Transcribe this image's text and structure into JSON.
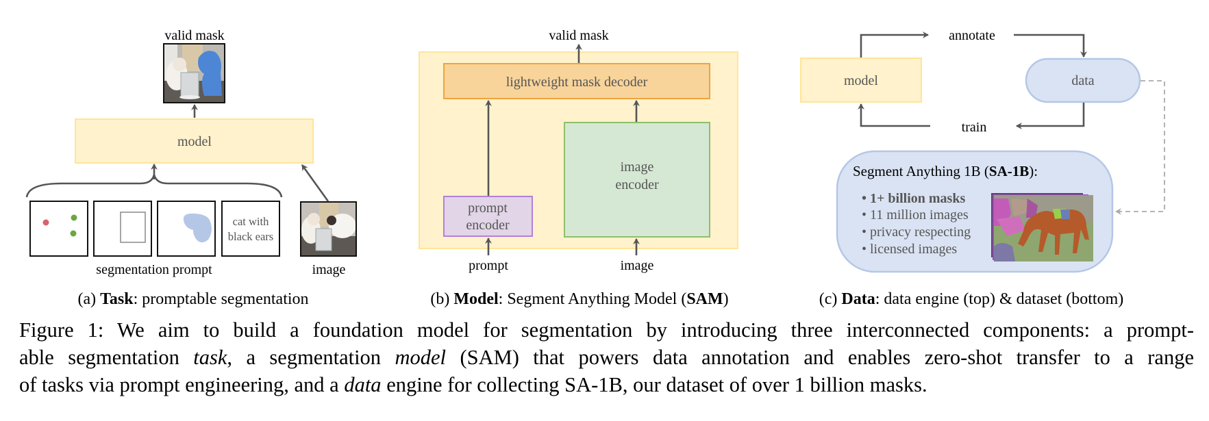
{
  "panel_a": {
    "output_label": "valid mask",
    "model_label": "model",
    "prompt_text_box": [
      "cat with",
      "black ears"
    ],
    "prompts_label": "segmentation prompt",
    "image_label": "image",
    "subcaption": {
      "prefix": "(a) ",
      "bold": "Task",
      "rest": ": promptable segmentation"
    },
    "point_colors": {
      "negative": "#d9636a",
      "positive": "#6aa83e"
    },
    "mask_color": "#b4c7e7"
  },
  "panel_b": {
    "output_label": "valid mask",
    "decoder_label": "lightweight mask decoder",
    "prompt_encoder_label": [
      "prompt",
      "encoder"
    ],
    "image_encoder_label": [
      "image",
      "encoder"
    ],
    "prompt_input_label": "prompt",
    "image_input_label": "image",
    "subcaption": {
      "prefix": "(b) ",
      "bold": "Model",
      "mid": ": Segment Anything Model (",
      "bold2": "SAM",
      "end": ")"
    }
  },
  "panel_c": {
    "model_label": "model",
    "data_label": "data",
    "annotate_label": "annotate",
    "train_label": "train",
    "dataset_title": {
      "prefix": "Segment Anything 1B (",
      "bold": "SA-1B",
      "end": "):"
    },
    "dataset_bullets": [
      {
        "text": "1+ billion masks",
        "bold": true
      },
      {
        "text": "11 million images",
        "bold": false
      },
      {
        "text": "privacy respecting",
        "bold": false
      },
      {
        "text": "licensed images",
        "bold": false
      }
    ],
    "subcaption": {
      "prefix": "(c) ",
      "bold": "Data",
      "rest": ": data engine (top) & dataset (bottom)"
    }
  },
  "colors": {
    "model_fill": "#fff2cc",
    "model_stroke": "#ffe599",
    "decoder_fill": "#f8d49a",
    "decoder_stroke": "#f0a43c",
    "prompt_enc_fill": "#e1d5e7",
    "prompt_enc_stroke": "#b57fd6",
    "image_enc_fill": "#d5e8d4",
    "image_enc_stroke": "#8fbf6b",
    "data_fill": "#dae3f3",
    "data_stroke": "#b4c7e7",
    "arrow": "#555555"
  },
  "figure_caption": {
    "lines": [
      [
        {
          "t": "Figure 1: We aim to build a foundation model for segmentation by introducing three interconnected components: a prompt-"
        }
      ],
      [
        {
          "t": "able segmentation "
        },
        {
          "t": "task",
          "i": true
        },
        {
          "t": ", a segmentation "
        },
        {
          "t": "model",
          "i": true
        },
        {
          "t": " (SAM) that powers data annotation and enables zero-shot transfer to a range"
        }
      ],
      [
        {
          "t": "of tasks via prompt engineering, and a "
        },
        {
          "t": "data",
          "i": true
        },
        {
          "t": " engine for collecting SA-1B, our dataset of over 1 billion masks."
        }
      ]
    ]
  }
}
